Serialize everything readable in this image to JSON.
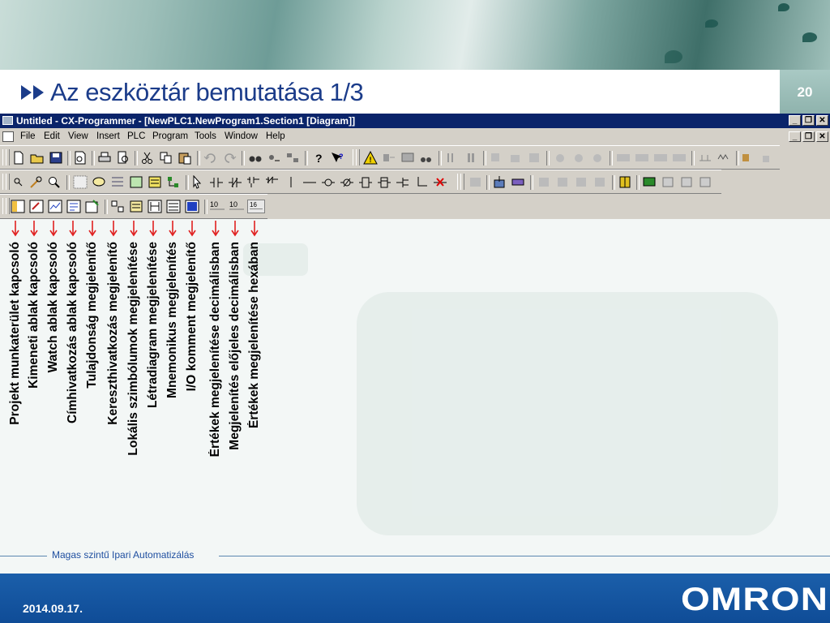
{
  "slide": {
    "title": "Az eszköztár bemutatása 1/3",
    "page_number": "20",
    "footer_text": "Magas szintű Ipari Automatizálás",
    "date": "2014.09.17.",
    "logo_text": "OMRON"
  },
  "app": {
    "window_title": "Untitled - CX-Programmer - [NewPLC1.NewProgram1.Section1 [Diagram]]",
    "menu": [
      "File",
      "Edit",
      "View",
      "Insert",
      "PLC",
      "Program",
      "Tools",
      "Window",
      "Help"
    ],
    "window_buttons": [
      "_",
      "❐",
      "✕"
    ],
    "toolbar_zoom_values": [
      "10",
      "10",
      "16"
    ]
  },
  "labels": [
    "Projekt munkaterület kapcsoló",
    "Kimeneti ablak kapcsoló",
    "Watch ablak kapcsoló",
    "Címhivatkozás ablak kapcsoló",
    "Tulajdonság megjelenítő",
    "Kereszthivatkozás megjelenítő",
    "Lokális szimbólumok megjelenítése",
    "Létradiagram megjelenítése",
    "Mnemonikus megjelenítés",
    "I/O komment megjelenítő",
    "Értékek megjelenítése decimálisban",
    "Megjelenítés előjeles decimálisban",
    "Értékek megjelenítése  hexában"
  ],
  "colors": {
    "title": "#1b3c8a",
    "arrow": "#e02020",
    "titlebar": "#0a246a",
    "footer_band": "#1458a6"
  }
}
